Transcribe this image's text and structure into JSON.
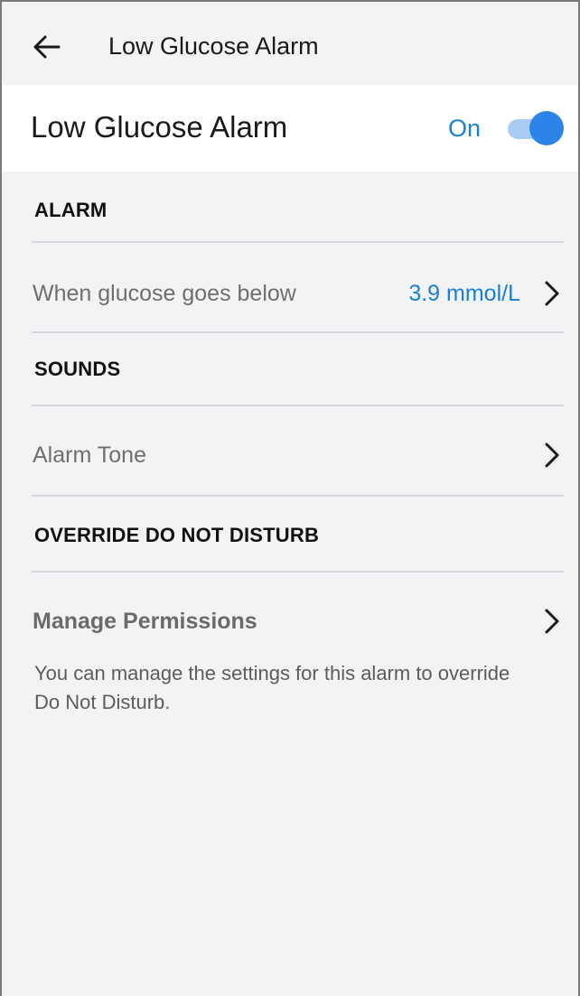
{
  "appbar": {
    "title": "Low Glucose Alarm",
    "back_icon": "arrow-left-icon"
  },
  "toggle": {
    "label": "Low Glucose Alarm",
    "state_label": "On",
    "enabled": true,
    "accent_color": "#2d84e8"
  },
  "sections": {
    "alarm": {
      "header": "ALARM",
      "threshold_label": "When glucose goes below",
      "threshold_value": "3.9 mmol/L"
    },
    "sounds": {
      "header": "SOUNDS",
      "tone_label": "Alarm Tone"
    },
    "dnd": {
      "header": "OVERRIDE DO NOT DISTURB",
      "permissions_label": "Manage Permissions",
      "helper_text": "You can manage the settings for this alarm to override Do Not Disturb."
    }
  },
  "icons": {
    "chevron": "chevron-right-icon"
  }
}
